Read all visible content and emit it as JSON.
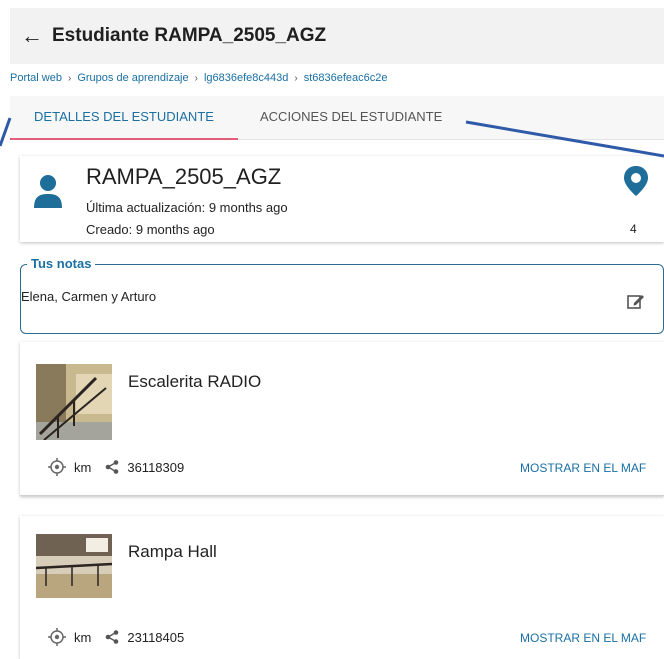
{
  "header": {
    "title": "Estudiante RAMPA_2505_AGZ"
  },
  "breadcrumb": [
    "Portal web",
    "Grupos de aprendizaje",
    "lg6836efe8c443d",
    "st6836efeac6c2e"
  ],
  "tabs": [
    {
      "label": "DETALLES DEL ESTUDIANTE",
      "active": true
    },
    {
      "label": "ACCIONES DEL ESTUDIANTE",
      "active": false
    }
  ],
  "student": {
    "name": "RAMPA_2505_AGZ",
    "last_update": "Última actualización: 9 months ago",
    "created": "Creado: 9 months ago",
    "location_count": "4"
  },
  "notes": {
    "legend": "Tus notas",
    "text": "Elena, Carmen y Arturo"
  },
  "places": [
    {
      "name": "Escalerita RADIO",
      "distance": "km",
      "share_id": "36118309",
      "map_label": "MOSTRAR EN EL MAF"
    },
    {
      "name": "Rampa Hall",
      "distance": "km",
      "share_id": "23118405",
      "map_label": "MOSTRAR EN EL MAF"
    }
  ],
  "colors": {
    "accent": "#1a6fa3",
    "tab_indicator": "#e0607a",
    "arrow": "#2f5aa8"
  }
}
